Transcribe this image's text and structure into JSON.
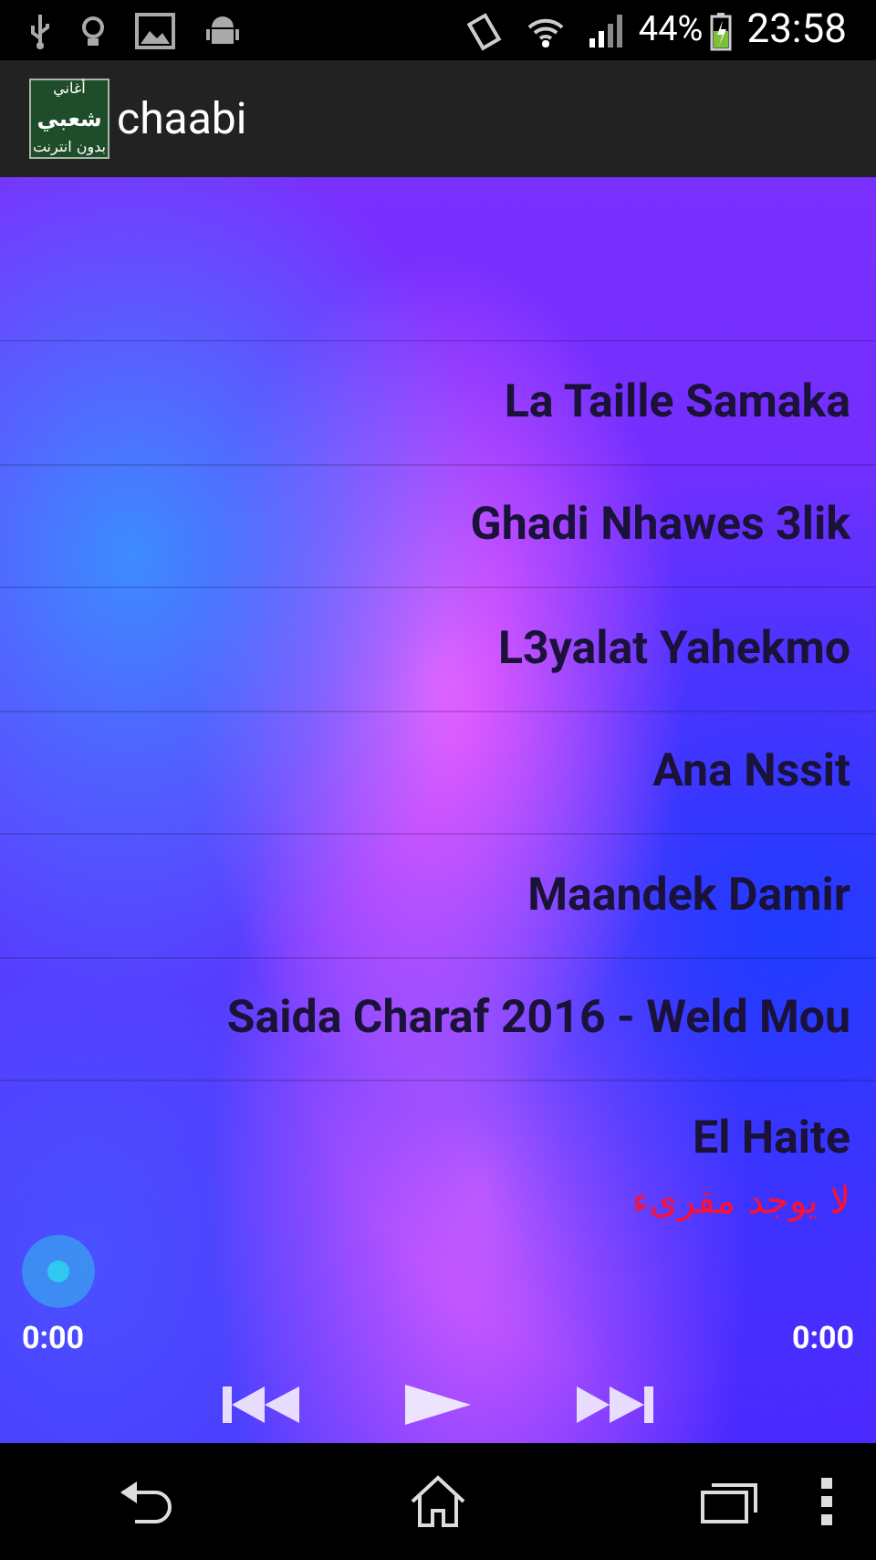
{
  "status_bar": {
    "battery": "44%",
    "time": "23:58"
  },
  "app_bar": {
    "logo_lines": [
      "أغاني",
      "شعبي",
      "بدون انترنت"
    ],
    "title": "chaabi"
  },
  "songs": [
    {
      "title": "La Taille Samaka"
    },
    {
      "title": "Ghadi Nhawes 3lik"
    },
    {
      "title": "L3yalat Yahekmo"
    },
    {
      "title": "Ana Nssit"
    },
    {
      "title": "Maandek Damir"
    },
    {
      "title": "Saida Charaf 2016 - Weld Mou"
    },
    {
      "title": "El Haite"
    }
  ],
  "player": {
    "message": "لا يوجد مقرىء",
    "elapsed": "0:00",
    "duration": "0:00"
  }
}
